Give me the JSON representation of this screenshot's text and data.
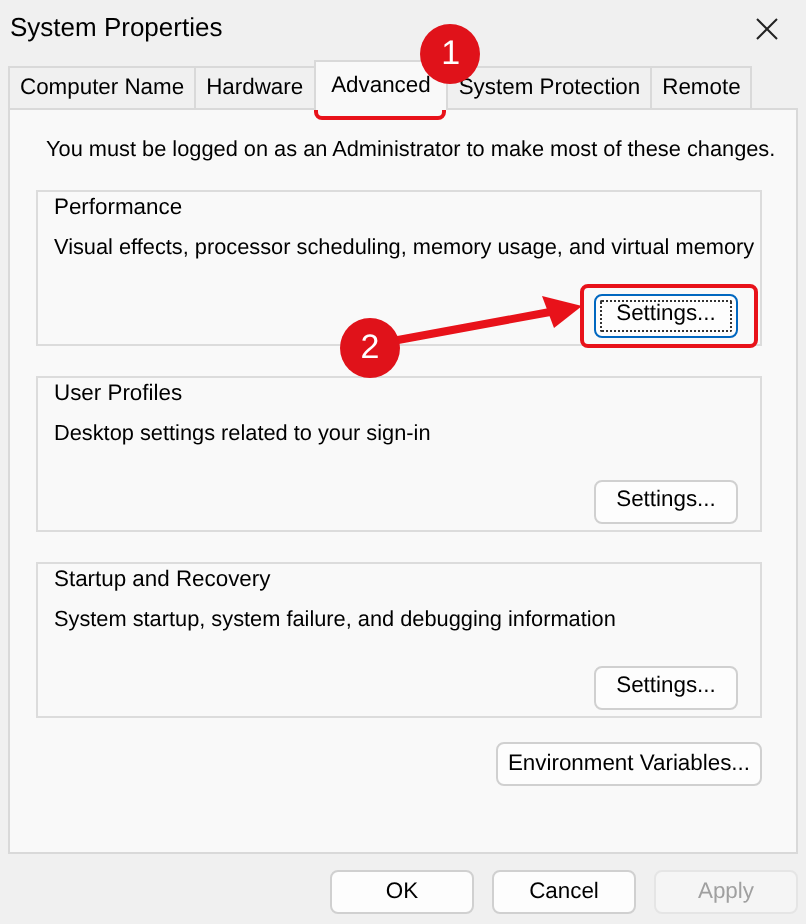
{
  "window": {
    "title": "System Properties"
  },
  "tabs": [
    {
      "label": "Computer Name",
      "selected": false
    },
    {
      "label": "Hardware",
      "selected": false
    },
    {
      "label": "Advanced",
      "selected": true,
      "highlighted": true,
      "step": "1"
    },
    {
      "label": "System Protection",
      "selected": false
    },
    {
      "label": "Remote",
      "selected": false
    }
  ],
  "notice": "You must be logged on as an Administrator to make most of these changes.",
  "groups": [
    {
      "title": "Performance",
      "description": "Visual effects, processor scheduling, memory usage, and virtual memory",
      "button": {
        "label": "Settings...",
        "focused": true,
        "highlighted": true,
        "step": "2",
        "arrow": true
      }
    },
    {
      "title": "User Profiles",
      "description": "Desktop settings related to your sign-in",
      "button": {
        "label": "Settings...",
        "focused": false
      }
    },
    {
      "title": "Startup and Recovery",
      "description": "System startup, system failure, and debugging information",
      "button": {
        "label": "Settings...",
        "focused": false
      }
    }
  ],
  "environment_button": {
    "label": "Environment Variables..."
  },
  "footer_buttons": [
    {
      "label": "OK",
      "disabled": false
    },
    {
      "label": "Cancel",
      "disabled": false
    },
    {
      "label": "Apply",
      "disabled": true
    }
  ]
}
